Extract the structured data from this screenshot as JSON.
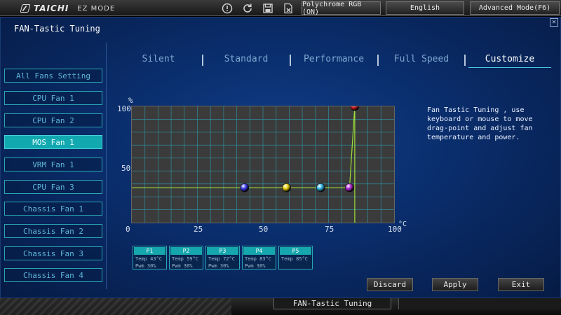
{
  "topbar": {
    "brand": "TAICHI",
    "mode_label": "EZ MODE",
    "polychrome_label": "Polychrome RGB (ON)",
    "language_label": "English",
    "advanced_label": "Advanced Mode(F6)",
    "icons": [
      "info-icon",
      "refresh-icon",
      "save-icon",
      "discard-file-icon"
    ]
  },
  "panel": {
    "title": "FAN-Tastic Tuning",
    "close_glyph": "✕"
  },
  "sidebar": {
    "items": [
      {
        "label": "All Fans Setting",
        "active": false
      },
      {
        "label": "CPU Fan 1",
        "active": false
      },
      {
        "label": "CPU Fan 2",
        "active": false
      },
      {
        "label": "MOS Fan 1",
        "active": true
      },
      {
        "label": "VRM Fan 1",
        "active": false
      },
      {
        "label": "CPU Fan 3",
        "active": false
      },
      {
        "label": "Chassis Fan 1",
        "active": false
      },
      {
        "label": "Chassis Fan 2",
        "active": false
      },
      {
        "label": "Chassis Fan 3",
        "active": false
      },
      {
        "label": "Chassis Fan 4",
        "active": false
      }
    ]
  },
  "tabs": [
    {
      "label": "Silent",
      "active": false
    },
    {
      "label": "Standard",
      "active": false
    },
    {
      "label": "Performance",
      "active": false
    },
    {
      "label": "Full Speed",
      "active": false
    },
    {
      "label": "Customize",
      "active": true
    }
  ],
  "graph": {
    "y_unit": "%",
    "x_unit": "°C",
    "y_ticks": [
      "0",
      "50",
      "100"
    ],
    "x_ticks": [
      "0",
      "25",
      "50",
      "75",
      "100"
    ],
    "points": [
      {
        "name": "P1",
        "temp": 43,
        "pwm": 30,
        "color": "#3b3be6"
      },
      {
        "name": "P2",
        "temp": 59,
        "pwm": 30,
        "color": "#e8d20f"
      },
      {
        "name": "P3",
        "temp": 72,
        "pwm": 30,
        "color": "#38b6e6"
      },
      {
        "name": "P4",
        "temp": 83,
        "pwm": 30,
        "color": "#b42ad6"
      },
      {
        "name": "P5",
        "temp": 85,
        "pwm": 100,
        "color": "#e0242a"
      }
    ]
  },
  "point_boxes": [
    {
      "title": "P1",
      "temp": "Temp 43°C",
      "pwm": "Pwm  30%"
    },
    {
      "title": "P2",
      "temp": "Temp 59°C",
      "pwm": "Pwm  30%"
    },
    {
      "title": "P3",
      "temp": "Temp 72°C",
      "pwm": "Pwm  30%"
    },
    {
      "title": "P4",
      "temp": "Temp 83°C",
      "pwm": "Pwm  30%"
    },
    {
      "title": "P5",
      "temp": "Temp 85°C",
      "pwm": ""
    }
  ],
  "help_text": "Fan Tastic Tuning , use keyboard or mouse to move drag-point and adjust fan temperature and power.",
  "actions": {
    "discard": "Discard",
    "apply": "Apply",
    "exit": "Exit"
  },
  "bottombar": {
    "label": "FAN-Tastic Tuning"
  }
}
